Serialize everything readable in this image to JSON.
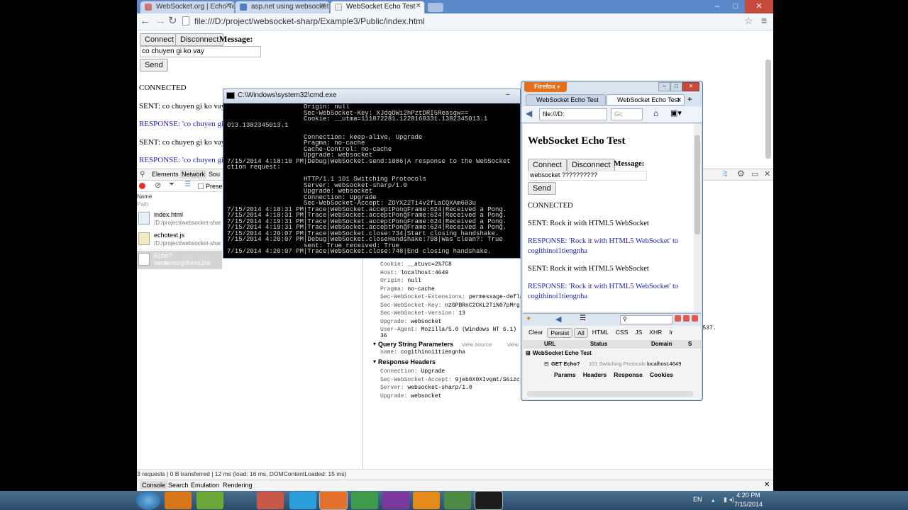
{
  "chrome": {
    "tabs": [
      {
        "label": "WebSocket.org | Echo Te"
      },
      {
        "label": "asp.net using websocket -"
      },
      {
        "label": "WebSocket Echo Test"
      }
    ],
    "url": "file:///D:/project/websocket-sharp/Example3/Public/index.html"
  },
  "page": {
    "connect_label": "Connect",
    "disconnect_label": "Disconnect",
    "message_label": "Message:",
    "message_value": "co chuyen gi ko vay",
    "send_label": "Send",
    "log": [
      {
        "text": "CONNECTED",
        "kind": "status"
      },
      {
        "text": "SENT: co chuyen gi ko vay",
        "kind": "sent"
      },
      {
        "text": "RESPONSE: 'co chuyen gi",
        "kind": "response"
      },
      {
        "text": "SENT: co chuyen gi ko vay",
        "kind": "sent"
      },
      {
        "text": "RESPONSE: 'co chuyen gi",
        "kind": "response"
      }
    ]
  },
  "devtools": {
    "tabs": [
      "Elements",
      "Network",
      "Sou"
    ],
    "preserve_label": "Preser",
    "name_header": "Name",
    "path_header": "Path",
    "requests": [
      {
        "name": "index.html",
        "path": "/D:/project/websocket-shar"
      },
      {
        "name": "echotest.js",
        "path": "/D:/project/websocket-shar"
      },
      {
        "name": "Echo?name=cogithinoi1tie",
        "path": "localhost"
      }
    ],
    "request_headers": [
      {
        "key": "Cookie:",
        "value": "__atuvc=2%7C8"
      },
      {
        "key": "Host:",
        "value": "localhost:4649"
      },
      {
        "key": "Origin:",
        "value": "null"
      },
      {
        "key": "Pragma:",
        "value": "no-cache"
      },
      {
        "key": "Sec-WebSocket-Extensions:",
        "value": "permessage-deflat"
      },
      {
        "key": "Sec-WebSocket-Key:",
        "value": "nzGPBRnC2CKL2TiN07pMrg"
      },
      {
        "key": "Sec-WebSocket-Version:",
        "value": "13"
      },
      {
        "key": "Upgrade:",
        "value": "websocket"
      },
      {
        "key": "User-Agent:",
        "value": "Mozilla/5.0 (Windows NT 6.1)"
      }
    ],
    "user_agent_tail": "6.153 Safari/537.",
    "user_agent_wrap": "36",
    "query_section": "Query String Parameters",
    "view_source": "view source",
    "view_parsed": "view",
    "query_params": [
      {
        "key": "name:",
        "value": "cogithinoi1tiengnha"
      }
    ],
    "response_section": "Response Headers",
    "response_headers": [
      {
        "key": "Connection:",
        "value": "Upgrade"
      },
      {
        "key": "Sec-WebSocket-Accept:",
        "value": "9jeb0X0XIvqmt/S6izc"
      },
      {
        "key": "Server:",
        "value": "websocket-sharp/1.0"
      },
      {
        "key": "Upgrade:",
        "value": "websocket"
      }
    ],
    "status_bar": "3 requests | 0 B transferred | 12 ms (load: 16 ms, DOMContentLoaded: 15 ms)",
    "drawer_tabs": [
      "Console",
      "Search",
      "Emulation",
      "Rendering"
    ]
  },
  "cmd": {
    "title": "C:\\Windows\\system32\\cmd.exe",
    "lines": [
      "                    Origin: null",
      "                    Sec-WebSocket-Key: XJdqOWi2hPztDRI5Reasqw==",
      "                    Cookie: __utma=111872281.1228168331.1382345013.1",
      "013.1382345013.1",
      "",
      "                    Connection: keep-alive, Upgrade",
      "                    Pragma: no-cache",
      "                    Cache-Control: no-cache",
      "                    Upgrade: websocket",
      "7/15/2014 4:18:10 PM|Debug|WebSocket.send:1086|A response to the WebSocket",
      "ction request:",
      "",
      "                    HTTP/1.1 101 Switching Protocols",
      "                    Server: websocket-sharp/1.0",
      "                    Upgrade: websocket",
      "                    Connection: Upgrade",
      "                    Sec-WebSocket-Accept: ZOYXZ2Ti4v2fLaCQXAm683u",
      "7/15/2014 4:18:31 PM|Trace|WebSocket.acceptPongFrame:624|Received a Pong.",
      "7/15/2014 4:18:31 PM|Trace|WebSocket.acceptPongFrame:624|Received a Pong.",
      "7/15/2014 4:19:31 PM|Trace|WebSocket.acceptPongFrame:624|Received a Pong.",
      "7/15/2014 4:19:31 PM|Trace|WebSocket.acceptPongFrame:624|Received a Pong.",
      "7/15/2014 4:20:07 PM|Trace|WebSocket.close:734|Start closing handshake.",
      "7/15/2014 4:20:07 PM|Debug|WebSocket.closeHandshake:798|Was clean?: True",
      "                    sent: True received: True",
      "7/15/2014 4:20:07 PM|Trace|WebSocket.close:748|End closing handshake."
    ]
  },
  "firefox": {
    "app_button": "Firefox",
    "tabs": [
      {
        "label": "WebSocket Echo Test"
      },
      {
        "label": "WebSocket Echo Test"
      }
    ],
    "url": "file:///D:",
    "search_placeholder": "Gc",
    "heading": "WebSocket Echo Test",
    "connect_label": "Connect",
    "disconnect_label": "Disconnect",
    "message_label": "Message:",
    "message_value": "websocket ??????????",
    "send_label": "Send",
    "log": [
      {
        "text": "CONNECTED",
        "kind": "status"
      },
      {
        "text": "SENT: Rock it with HTML5 WebSocket",
        "kind": "sent"
      },
      {
        "text": "RESPONSE: 'Rock it with HTML5 WebSocket' to cogithinoi1tiengnha",
        "kind": "response"
      },
      {
        "text": "SENT: Rock it with HTML5 WebSocket",
        "kind": "sent"
      },
      {
        "text": "RESPONSE: 'Rock it with HTML5 WebSocket' to cogithinoi1tiengnha",
        "kind": "response"
      }
    ],
    "firebug": {
      "buttons": [
        "Clear",
        "Persist",
        "All",
        "HTML",
        "CSS",
        "JS",
        "XHR",
        "Ir"
      ],
      "columns": [
        "URL",
        "Status",
        "Domain",
        "S"
      ],
      "group": "WebSocket Echo Test",
      "request": {
        "method": "GET Echo?",
        "status": "101 Switching Protocols",
        "domain": "localhost:4649"
      },
      "detail_tabs": [
        "Params",
        "Headers",
        "Response",
        "Cookies"
      ]
    }
  },
  "taskbar": {
    "lang": "EN",
    "time": "4:20 PM",
    "date": "7/15/2014"
  }
}
